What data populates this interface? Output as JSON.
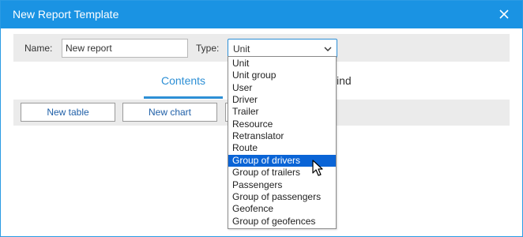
{
  "dialog": {
    "title": "New Report Template"
  },
  "form": {
    "name_label": "Name:",
    "name_value": "New report",
    "type_label": "Type:",
    "type_value": "Unit"
  },
  "tabs": [
    {
      "label": "Contents",
      "active": true
    },
    {
      "label": "ind",
      "active": false
    }
  ],
  "toolbar": {
    "new_table_label": "New table",
    "new_chart_label": "New chart"
  },
  "type_options": [
    "Unit",
    "Unit group",
    "User",
    "Driver",
    "Trailer",
    "Resource",
    "Retranslator",
    "Route",
    "Group of drivers",
    "Group of trailers",
    "Passengers",
    "Group of passengers",
    "Geofence",
    "Group of geofences"
  ],
  "highlighted_option": "Group of drivers",
  "colors": {
    "titlebar": "#1a93e3",
    "accent": "#2d8fd5",
    "highlight": "#0a64d6",
    "panel": "#ebebeb"
  },
  "icons": {
    "close": "close-icon",
    "dropdown": "chevron-down-icon",
    "cursor": "mouse-pointer-icon"
  }
}
